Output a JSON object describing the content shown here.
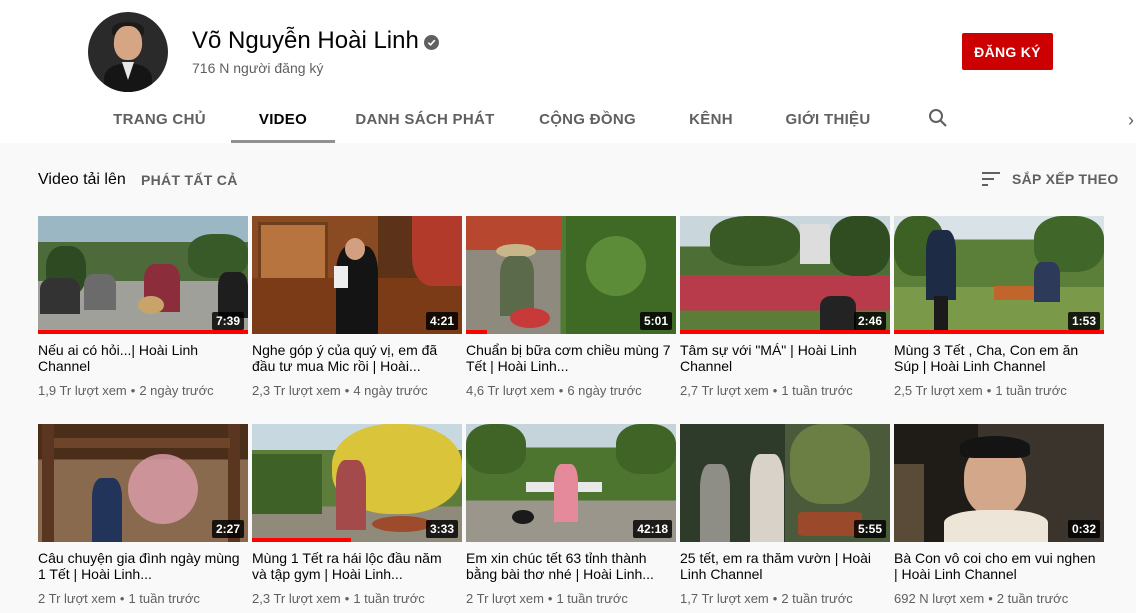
{
  "channel": {
    "name": "Võ Nguyễn Hoài Linh",
    "subscribers": "716 N người đăng ký",
    "subscribe_label": "ĐĂNG KÝ",
    "accent": "#cc0000"
  },
  "tabs": [
    {
      "label": "TRANG CHỦ",
      "active": false
    },
    {
      "label": "VIDEO",
      "active": true
    },
    {
      "label": "DANH SÁCH PHÁT",
      "active": false
    },
    {
      "label": "CỘNG ĐỒNG",
      "active": false
    },
    {
      "label": "KÊNH",
      "active": false
    },
    {
      "label": "GIỚI THIỆU",
      "active": false
    }
  ],
  "section": {
    "title": "Video tải lên",
    "play_all": "PHÁT TẤT CẢ",
    "sort_label": "SẮP XẾP THEO"
  },
  "videos": [
    {
      "title": "Nếu ai có hỏi...| Hoài Linh Channel",
      "duration": "7:39",
      "views": "1,9 Tr lượt xem",
      "age": "2 ngày trước",
      "watched": 1.0
    },
    {
      "title": "Nghe góp ý của quý vị, em đã đầu tư mua Mic rồi | Hoài...",
      "duration": "4:21",
      "views": "2,3 Tr lượt xem",
      "age": "4 ngày trước",
      "watched": 0
    },
    {
      "title": "Chuẩn bị bữa cơm chiều mùng 7 Tết | Hoài Linh...",
      "duration": "5:01",
      "views": "4,6 Tr lượt xem",
      "age": "6 ngày trước",
      "watched": 0.1
    },
    {
      "title": "Tâm sự với \"MÁ\" | Hoài Linh Channel",
      "duration": "2:46",
      "views": "2,7 Tr lượt xem",
      "age": "1 tuần trước",
      "watched": 1.0
    },
    {
      "title": "Mùng 3 Tết , Cha, Con em ăn Súp | Hoài Linh Channel",
      "duration": "1:53",
      "views": "2,5 Tr lượt xem",
      "age": "1 tuần trước",
      "watched": 1.0
    },
    {
      "title": "Câu chuyện gia đình ngày mùng 1 Tết | Hoài Linh...",
      "duration": "2:27",
      "views": "2 Tr lượt xem",
      "age": "1 tuần trước",
      "watched": 0
    },
    {
      "title": "Mùng 1 Tết ra hái lộc đầu năm và tập gym | Hoài Linh...",
      "duration": "3:33",
      "views": "2,3 Tr lượt xem",
      "age": "1 tuần trước",
      "watched": 0.47
    },
    {
      "title": "Em xin chúc tết 63 tỉnh thành bằng bài thơ nhé | Hoài Linh...",
      "duration": "42:18",
      "views": "2 Tr lượt xem",
      "age": "1 tuần trước",
      "watched": 0
    },
    {
      "title": "25 tết, em ra thăm vườn | Hoài Linh Channel",
      "duration": "5:55",
      "views": "1,7 Tr lượt xem",
      "age": "2 tuần trước",
      "watched": 0
    },
    {
      "title": "Bà Con vô coi cho em vui nghen | Hoài Linh Channel",
      "duration": "0:32",
      "views": "692 N lượt xem",
      "age": "2 tuần trước",
      "watched": 0
    }
  ]
}
